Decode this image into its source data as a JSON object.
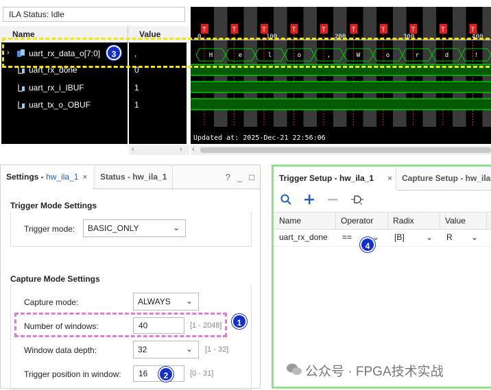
{
  "ila_status": {
    "text": "ILA Status: Idle"
  },
  "signals": {
    "col_name": "Name",
    "col_value": "Value",
    "rows": [
      {
        "name": "uart_rx_data_o[7:0]",
        "value": ","
      },
      {
        "name": "uart_rx_done",
        "value": "0"
      },
      {
        "name": "uart_rx_i_IBUF",
        "value": "1"
      },
      {
        "name": "uart_tx_o_OBUF",
        "value": "1"
      }
    ]
  },
  "waveform": {
    "updated": "Updated at: 2025-Dec-21 22:56:06",
    "axis_labels": [
      "0",
      "100",
      "200",
      "300",
      "400"
    ],
    "trigger_marker": "T",
    "data_chars": [
      "H",
      "e",
      "l",
      "o",
      ",",
      "W",
      "o",
      "r",
      "d",
      "!"
    ],
    "colors": {
      "background": "#000000",
      "signal": "#00c800",
      "marker": "#e02020",
      "bus": "#ffffff"
    }
  },
  "settings": {
    "tab_active_bold": "Settings - ",
    "tab_active_blue": "hw_ila_1",
    "tab_close": "×",
    "tab_inactive": "Status - hw_ila_1",
    "icons": [
      "?",
      "_",
      "□"
    ],
    "trigger_mode_title": "Trigger Mode Settings",
    "trigger_mode_label": "Trigger mode:",
    "trigger_mode_value": "BASIC_ONLY",
    "capture_title": "Capture Mode Settings",
    "capture_mode_label": "Capture mode:",
    "capture_mode_value": "ALWAYS",
    "windows_label": "Number of windows:",
    "windows_value": "40",
    "windows_range": "[1 - 2048]",
    "depth_label": "Window data depth:",
    "depth_value": "32",
    "depth_range": "[1 - 32]",
    "trigpos_label": "Trigger position in window:",
    "trigpos_value": "16",
    "trigpos_range": "[0 - 31]"
  },
  "trigger": {
    "tab_active": "Trigger Setup - hw_ila_1",
    "tab_close": "×",
    "tab_inactive": "Capture Setup - hw_ila",
    "columns": [
      "Name",
      "Operator",
      "Radix",
      "Value"
    ],
    "row": {
      "name": "uart_rx_done",
      "operator": "==",
      "radix": "[B]",
      "value": "R"
    }
  },
  "badges": [
    "1",
    "2",
    "3",
    "4"
  ],
  "watermark": "公众号 · FPGA技术实战",
  "colors": {
    "highlight_yellow": "#f3e414",
    "highlight_pink": "#e07ad9",
    "badge": "#1530c8",
    "panel_green": "#90e090",
    "link_blue": "#1f5fbf"
  }
}
